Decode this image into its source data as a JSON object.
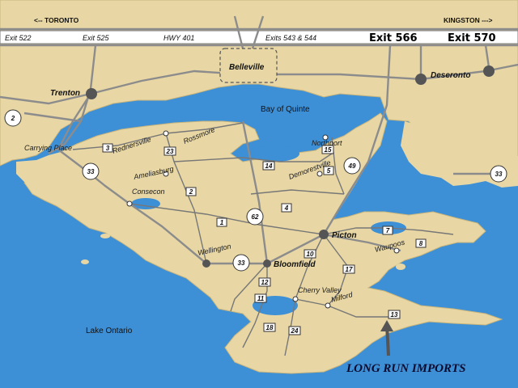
{
  "directions": {
    "west": "<-- TORONTO",
    "east": "KINGSTON --->"
  },
  "highway_bar": {
    "exit_522": "Exit 522",
    "exit_525": "Exit 525",
    "hwy_name": "HWY 401",
    "exits_543_544": "Exits 543 & 544",
    "exit_566": "Exit 566",
    "exit_570": "Exit 570"
  },
  "towns": {
    "belleville": "Belleville",
    "trenton": "Trenton",
    "deseronto": "Deseronto",
    "rednersville": "Rednersville",
    "rossmore": "Rossmore",
    "ameliasburg": "Ameliasburg",
    "carrying_place": "Carrying Place",
    "consecon": "Consecon",
    "northport": "Northport",
    "demorestville": "Demorestville",
    "picton": "Picton",
    "wellington": "Wellington",
    "bloomfield": "Bloomfield",
    "waupoos": "Waupoos",
    "cherry_valley": "Cherry Valley",
    "milford": "Milford"
  },
  "water": {
    "bay_of_quinte": "Bay of Quinte",
    "lake_ontario": "Lake Ontario"
  },
  "highways": {
    "h2": "2",
    "h33_west": "33",
    "h33_east": "33",
    "h33_south": "33",
    "h49": "49",
    "h62": "62"
  },
  "county_roads": {
    "r1": "1",
    "r2": "2",
    "r3": "3",
    "r4": "4",
    "r5": "5",
    "r7": "7",
    "r8": "8",
    "r10": "10",
    "r11": "11",
    "r12": "12",
    "r13": "13",
    "r14": "14",
    "r15": "15",
    "r17": "17",
    "r18": "18",
    "r23": "23",
    "r24": "24"
  },
  "credit": "LONG RUN IMPORTS",
  "colors": {
    "water": "#3d8fd6",
    "land": "#e8d7a4",
    "road": "#777777",
    "town_dot": "#555555"
  }
}
